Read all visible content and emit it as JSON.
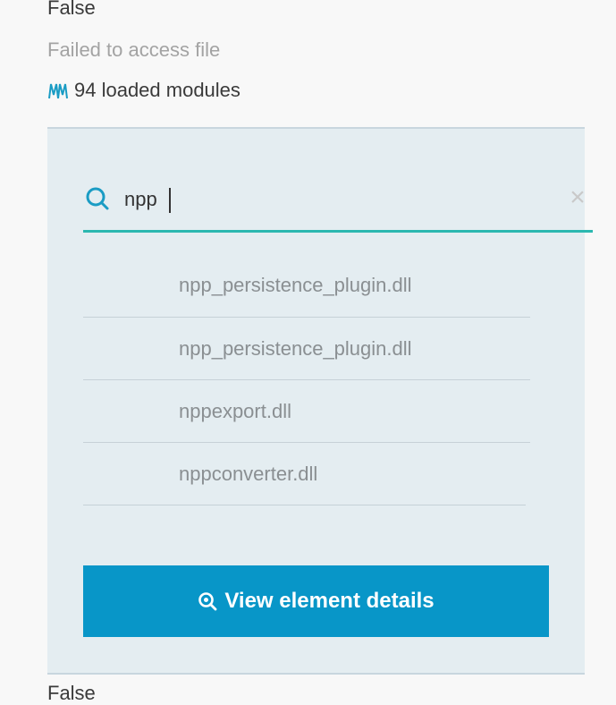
{
  "top_value": "False",
  "error_message": "Failed to access file",
  "modules": {
    "icon": "modules-icon",
    "label": "94 loaded modules"
  },
  "search": {
    "value": "npp",
    "placeholder": ""
  },
  "results": [
    "npp_persistence_plugin.dll",
    "npp_persistence_plugin.dll",
    "nppexport.dll",
    "nppconverter.dll"
  ],
  "view_button": {
    "icon": "zoom-in-icon",
    "label": "View element details"
  },
  "bottom_value": "False",
  "colors": {
    "accent": "#2bb8b0",
    "button": "#0896c8",
    "panel": "#e4edf1"
  }
}
